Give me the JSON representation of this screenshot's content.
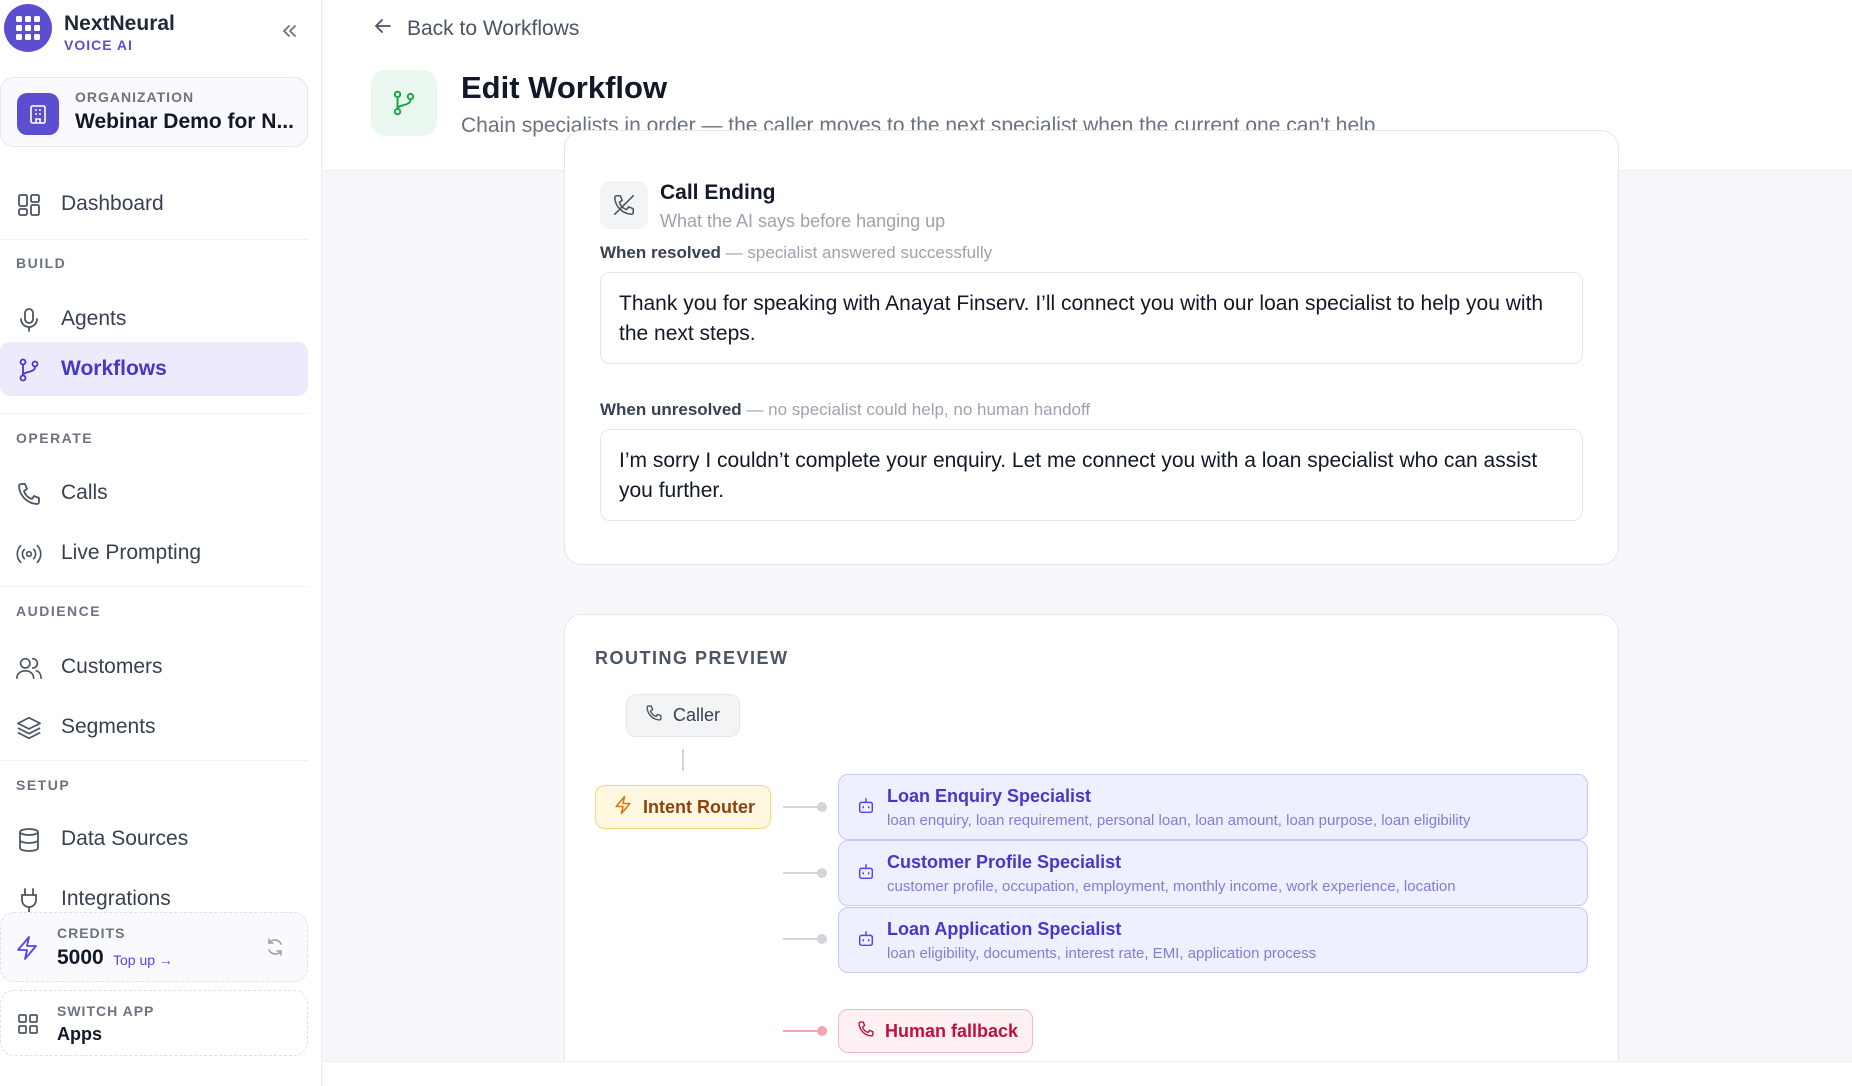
{
  "brand": {
    "name": "NextNeural",
    "subtitle": "VOICE AI"
  },
  "organization": {
    "label": "ORGANIZATION",
    "name": "Webinar Demo for N..."
  },
  "sidebar": {
    "dashboard": "Dashboard",
    "sections": {
      "build": "BUILD",
      "operate": "OPERATE",
      "audience": "AUDIENCE",
      "setup": "SETUP"
    },
    "items": {
      "agents": "Agents",
      "workflows": "Workflows",
      "calls": "Calls",
      "live_prompting": "Live Prompting",
      "customers": "Customers",
      "segments": "Segments",
      "data_sources": "Data Sources",
      "integrations": "Integrations"
    },
    "active": "workflows"
  },
  "credits": {
    "label": "CREDITS",
    "value": "5000",
    "top_up": "Top up →"
  },
  "switch_app": {
    "label": "SWITCH APP",
    "value": "Apps"
  },
  "header": {
    "back": "Back to Workflows",
    "title": "Edit Workflow",
    "subtitle": "Chain specialists in order — the caller moves to the next specialist when the current one can't help"
  },
  "call_ending": {
    "title": "Call Ending",
    "subtitle": "What the AI says before hanging up",
    "resolved_label": "When resolved",
    "resolved_hint": "— specialist answered successfully",
    "resolved_text": "Thank you for speaking with Anayat Finserv. I’ll connect you with our loan specialist to help you with the next steps.",
    "unresolved_label": "When unresolved",
    "unresolved_hint": "— no specialist could help, no human handoff",
    "unresolved_text": "I’m sorry I couldn’t complete your enquiry. Let me connect you with a loan specialist who can assist you further."
  },
  "routing": {
    "title": "ROUTING PREVIEW",
    "caller": "Caller",
    "router": "Intent Router",
    "specialists": [
      {
        "name": "Loan Enquiry Specialist",
        "keywords": "loan enquiry, loan requirement, personal loan, loan amount, loan purpose, loan eligibility"
      },
      {
        "name": "Customer Profile Specialist",
        "keywords": "customer profile, occupation, employment, monthly income, work experience, location"
      },
      {
        "name": "Loan Application Specialist",
        "keywords": "loan eligibility, documents, interest rate, EMI, application process"
      }
    ],
    "fallback": "Human fallback"
  },
  "colors": {
    "accent": "#5b4fcf",
    "active_bg": "#eceafb",
    "router_bg": "#fff8e1",
    "specialist_bg": "#eef0ff",
    "fallback_text": "#be123c"
  }
}
